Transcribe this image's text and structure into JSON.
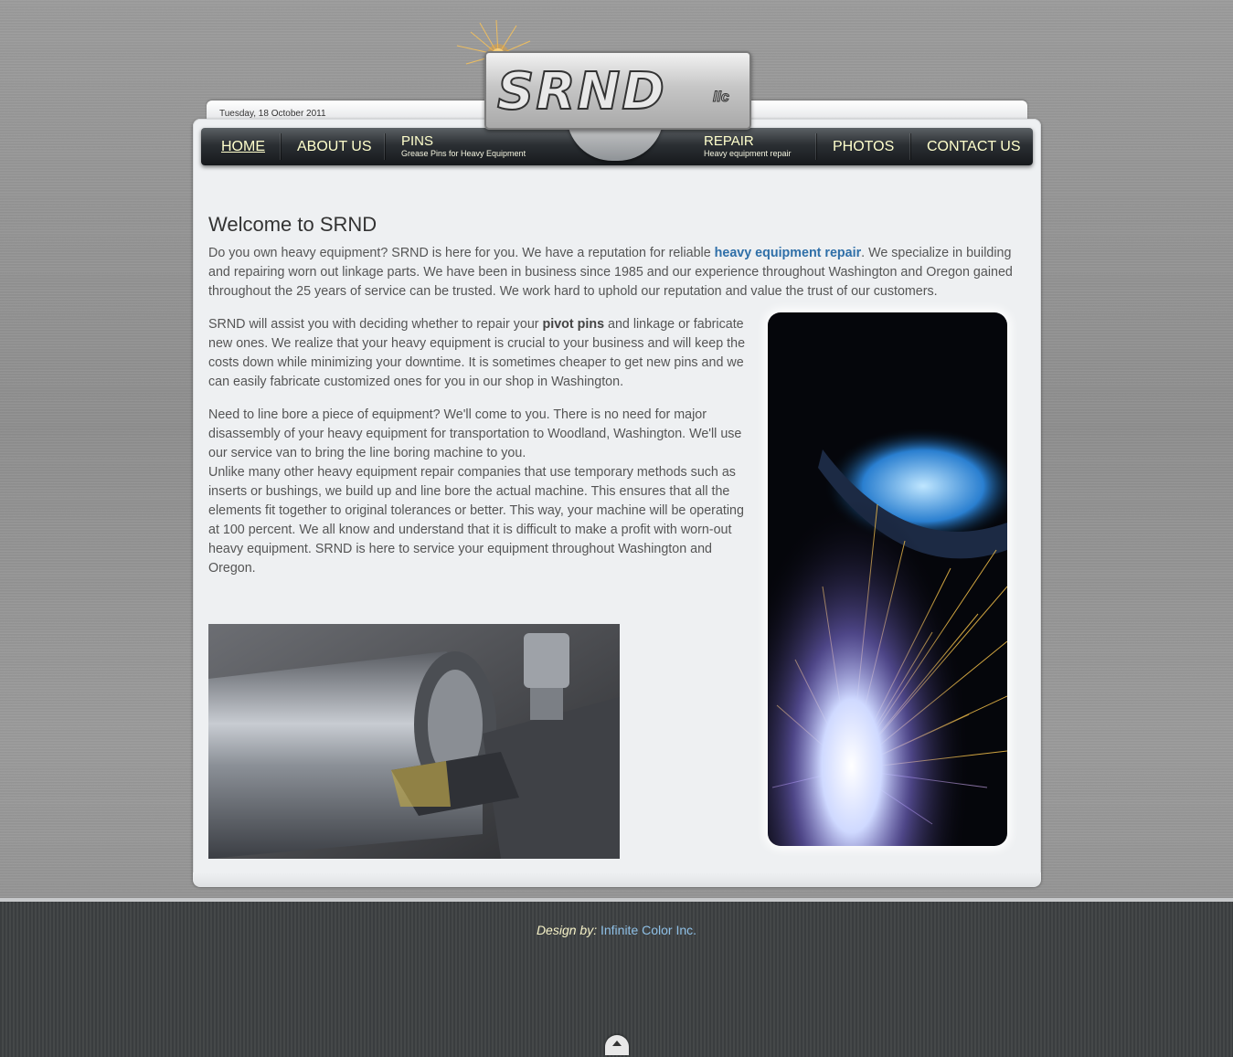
{
  "header": {
    "date": "Tuesday, 18 October 2011",
    "logo_text": "SRND",
    "logo_suffix": "llc"
  },
  "nav": {
    "home": "HOME",
    "about": "ABOUT US",
    "pins_title": "PINS",
    "pins_sub": "Grease Pins for Heavy Equipment",
    "repair_title": "REPAIR",
    "repair_sub": "Heavy equipment repair",
    "photos": "PHOTOS",
    "contact": "CONTACT US"
  },
  "main": {
    "heading": "Welcome to SRND",
    "p1_a": "Do you own heavy equipment? SRND is here for you. We have a reputation for reliable ",
    "p1_link": "heavy equipment repair",
    "p1_b": ". We specialize in building and repairing worn out linkage parts. We have been in business since 1985 and our experience throughout Washington and Oregon gained throughout the 25 years of service can be trusted. We work hard to uphold our reputation and value the trust of our customers.",
    "p2_a": "SRND will assist you with deciding whether to repair your ",
    "p2_bold": "pivot pins",
    "p2_b": " and linkage or fabricate new ones. We realize that your heavy equipment is crucial to your business and will keep the costs down while minimizing your downtime. It is sometimes cheaper to get new pins and we can easily fabricate customized ones for you in our shop in Washington.",
    "p3_a": "Need to line bore a piece of equipment? We'll come to you. There is no need for major disassembly of your heavy equipment for transportation to Woodland, Washington. We'll use our service van to bring the line boring machine to you.",
    "p3_b": "Unlike many other heavy equipment repair companies that use temporary methods such as inserts or bushings, we build up and line bore the actual machine. This ensures that all the elements fit together to original tolerances or better. This way, your machine will be operating at 100 percent. We all know and understand that it is difficult to make a profit with worn-out heavy equipment. SRND is here to service your equipment throughout Washington and Oregon."
  },
  "footer": {
    "design_label": "Design by:",
    "designer": "Infinite Color Inc."
  },
  "colors": {
    "link": "#2f6fa8",
    "nav_text": "#ffffcc",
    "footer_bg": "#404345"
  }
}
